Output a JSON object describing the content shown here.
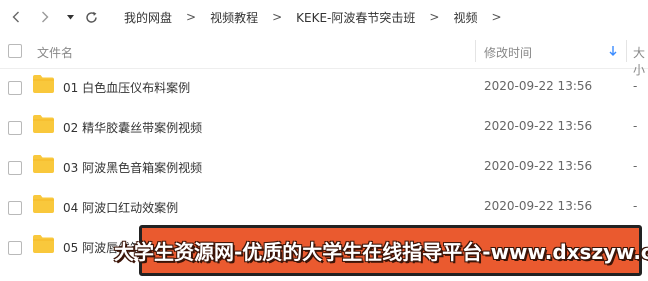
{
  "toolbar": {
    "back_icon": "chevron-left-icon",
    "forward_icon": "chevron-right-icon",
    "history_icon": "caret-down-icon",
    "refresh_icon": "refresh-icon",
    "breadcrumb": [
      {
        "label": "我的网盘"
      },
      {
        "label": "视频教程"
      },
      {
        "label": "KEKE-阿波春节突击班"
      },
      {
        "label": "视频"
      }
    ],
    "separator": ">"
  },
  "header": {
    "name": "文件名",
    "mtime": "修改时间",
    "sort_icon": "sort-down-arrow-icon",
    "size": "大小"
  },
  "files": [
    {
      "name": "01 白色血压仪布料案例",
      "mtime": "2020-09-22 13:56",
      "size": "-"
    },
    {
      "name": "02 精华胶囊丝带案例视频",
      "mtime": "2020-09-22 13:56",
      "size": "-"
    },
    {
      "name": "03 阿波黑色音箱案例视频",
      "mtime": "2020-09-22 13:56",
      "size": "-"
    },
    {
      "name": "04 阿波口红动效案例",
      "mtime": "2020-09-22 13:56",
      "size": "-"
    },
    {
      "name": "05 阿波唇线笔",
      "mtime": "",
      "size": ""
    }
  ],
  "watermark": {
    "text": "大学生资源网-优质的大学生在线指导平台-www.dxszyw.cn",
    "background": "#ea5a2f"
  },
  "colors": {
    "folder": "#f9c83c",
    "accent": "#3b8cff"
  }
}
